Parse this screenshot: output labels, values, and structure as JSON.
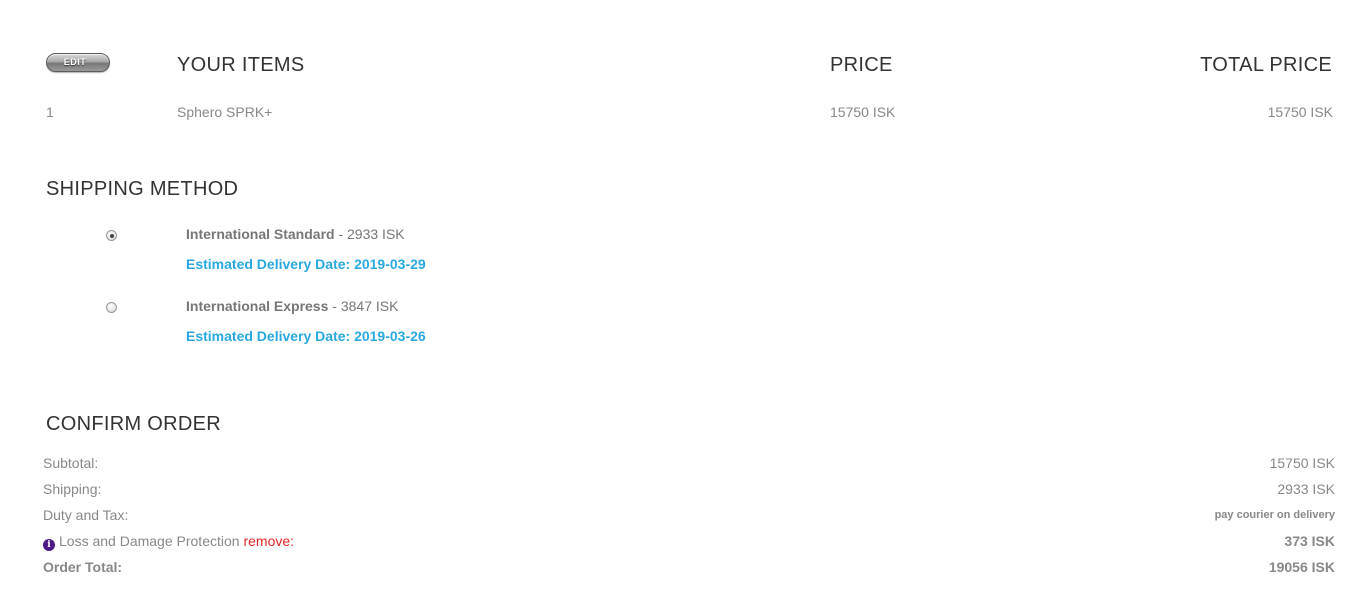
{
  "cart": {
    "edit_label": "EDIT",
    "headers": {
      "items": "YOUR ITEMS",
      "price": "PRICE",
      "total": "TOTAL PRICE"
    },
    "items": [
      {
        "qty": "1",
        "name": "Sphero SPRK+",
        "price": "15750 ISK",
        "total": "15750 ISK"
      }
    ]
  },
  "shipping": {
    "title": "SHIPPING METHOD",
    "options": [
      {
        "name": "International Standard",
        "price": " - 2933 ISK",
        "eta": "Estimated Delivery Date: 2019-03-29",
        "selected": true
      },
      {
        "name": "International Express",
        "price": " - 3847 ISK",
        "eta": "Estimated Delivery Date: 2019-03-26",
        "selected": false
      }
    ]
  },
  "confirm": {
    "title": "CONFIRM ORDER",
    "subtotal_label": "Subtotal:",
    "subtotal_value": "15750 ISK",
    "shipping_label": "Shipping:",
    "shipping_value": "2933 ISK",
    "duty_label": "Duty and Tax:",
    "duty_value": "pay courier on delivery",
    "protection_icon": "i",
    "protection_label": "Loss and Damage Protection ",
    "protection_remove": "remove",
    "protection_colon": ":",
    "protection_value": "373 ISK",
    "total_label": "Order Total:",
    "total_value": "19056 ISK"
  },
  "colors": {
    "accent": "#29a8e0",
    "remove": "#e02424",
    "info_icon": "#4b1a86"
  }
}
